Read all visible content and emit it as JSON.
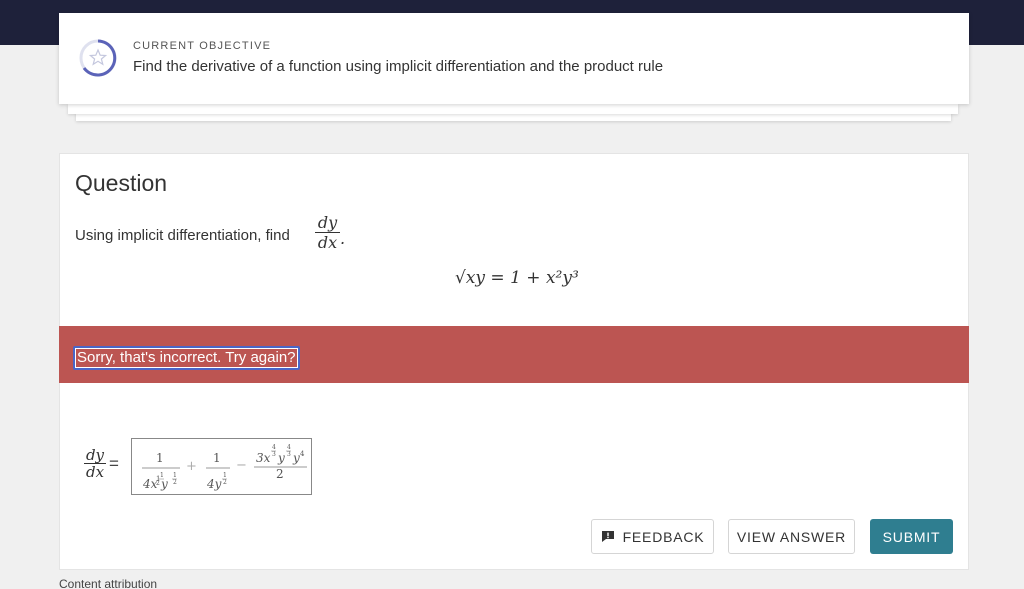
{
  "objective": {
    "eyebrow": "CURRENT OBJECTIVE",
    "text": "Find the derivative of a function using implicit differentiation and the product rule",
    "icon": "star-icon"
  },
  "question": {
    "title": "Question",
    "prompt": "Using implicit differentiation, find",
    "frac_num": "dy",
    "frac_den": "dx",
    "equation": "√xy = 1 + x²y³"
  },
  "feedback_banner": {
    "text": "Sorry, that's incorrect. Try again?",
    "color": "#bc5552"
  },
  "answer": {
    "lhs_num": "dy",
    "lhs_den": "dx",
    "expression": "1 / (4x^(1/2) y^(1/2)) + 1 / (4y^(1/2)) − (3x^(4/3) y^(4/3) y^4) / 2"
  },
  "buttons": {
    "feedback": "FEEDBACK",
    "view_answer": "VIEW ANSWER",
    "submit": "SUBMIT"
  },
  "footer": {
    "attribution": "Content attribution"
  },
  "colors": {
    "topbar": "#1e213a",
    "submit": "#2f7e90",
    "ring_accent": "#5b63b8"
  }
}
